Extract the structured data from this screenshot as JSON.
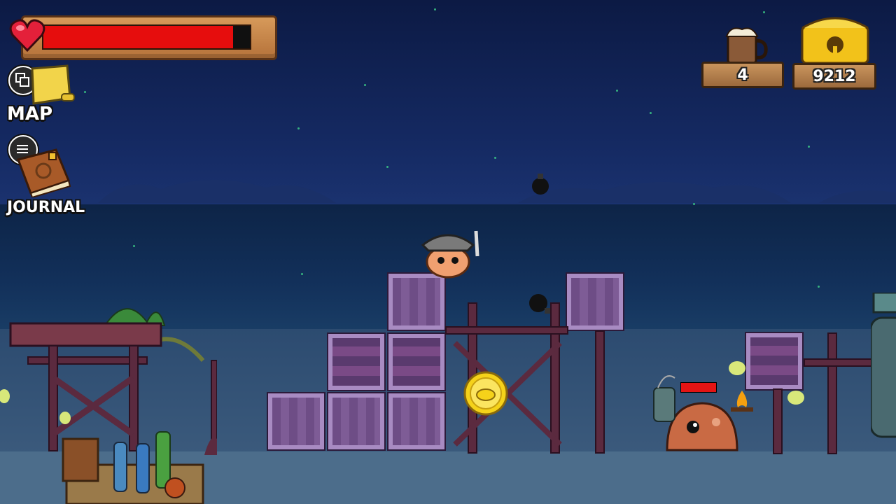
{
  "hud": {
    "health_percent": 92,
    "map_label": "MAP",
    "journal_label": "JOURNAL",
    "mug_count": "4",
    "treasure_count": "9212"
  },
  "colors": {
    "health_fill": "#e60d0d",
    "plank_wood": "#c9945d",
    "crate_purple": "#7e5c96",
    "slime": "#c96a44"
  },
  "icons": {
    "map": "map-scroll-icon",
    "journal": "journal-book-icon",
    "mug": "root-beer-mug-icon",
    "treasure": "treasure-chest-icon",
    "heart": "heart-icon",
    "window_toggle": "windows-icon",
    "menu": "hamburger-menu-icon"
  },
  "enemy": {
    "health_percent": 100
  }
}
